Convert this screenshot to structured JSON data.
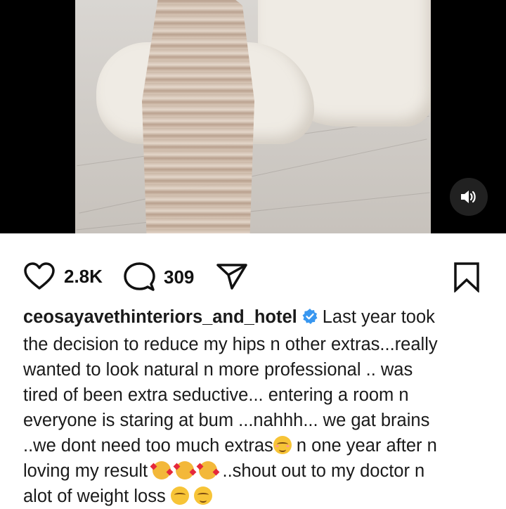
{
  "post": {
    "likes": "2.8K",
    "comments": "309"
  },
  "caption": {
    "username": "ceosayavethinteriors_and_hotel",
    "line1_text": "Last year took",
    "line2": "the decision to reduce my hips n other extras...really",
    "line3": "wanted to look natural n more professional .. was",
    "line4": "tired of been extra seductive... entering a room n",
    "line5": "everyone is staring at bum ...nahhh... we gat brains",
    "line6_a": "..we dont need too much extras",
    "line6_b": " n one year after n",
    "line7_a": "loving my result ",
    "line7_b": " ..shout out to my doctor n",
    "line8_a": "alot of weight loss "
  },
  "colors": {
    "verified_badge": "#3897f0",
    "text": "#1a1a1a",
    "icon": "#111111"
  },
  "icons": {
    "audio": "speaker-icon",
    "like": "heart-icon",
    "comment": "comment-bubble-icon",
    "share": "paper-plane-icon",
    "save": "bookmark-icon",
    "verified": "verified-badge-icon"
  }
}
